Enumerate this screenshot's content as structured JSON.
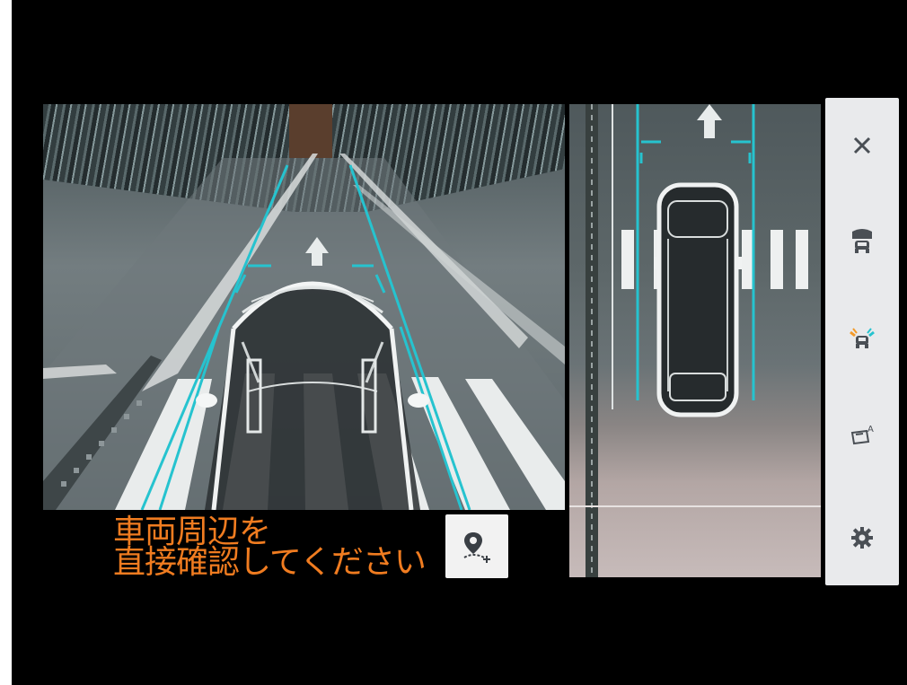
{
  "message": {
    "line1": "車両周辺を",
    "line2": "直接確認してください"
  },
  "icons": {
    "close": "close-icon",
    "front_view": "vehicle-front-view-icon",
    "sensor_alert": "sensor-alert-icon",
    "auto_view": "auto-view-icon",
    "settings": "gear-icon",
    "add_location": "add-location-pin-icon"
  },
  "colors": {
    "guide_line": "#26c3cf",
    "message_text": "#f07c20",
    "sidebar_bg": "#e9eaec",
    "icon": "#4a4f55"
  }
}
